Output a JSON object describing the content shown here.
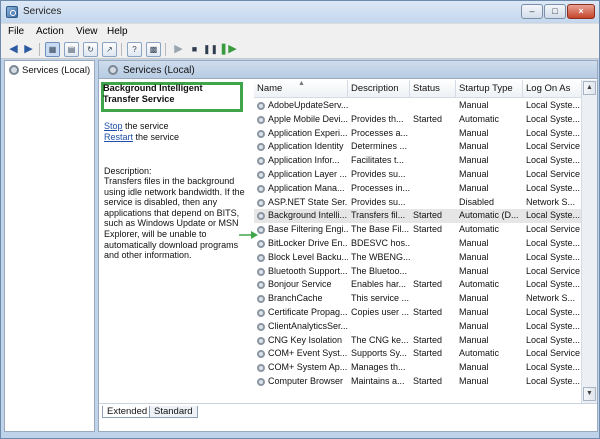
{
  "window": {
    "title": "Services"
  },
  "menu": [
    "File",
    "Action",
    "View",
    "Help"
  ],
  "toolbar": {
    "buttons": [
      "back",
      "forward",
      "show-console-tree",
      "properties",
      "refresh",
      "export-list",
      "help",
      "action-pane",
      "start",
      "stop",
      "pause",
      "restart"
    ]
  },
  "tree": {
    "root_label": "Services (Local)"
  },
  "right_header": {
    "label": "Services (Local)"
  },
  "details": {
    "selected_title": "Background Intelligent Transfer Service",
    "stop_link": "Stop",
    "stop_rest": " the service",
    "restart_link": "Restart",
    "restart_rest": " the service",
    "description_label": "Description:",
    "description_text": "Transfers files in the background using idle network bandwidth. If the service is disabled, then any applications that depend on BITS, such as Windows Update or MSN Explorer, will be unable to automatically download programs and other information."
  },
  "table": {
    "columns": [
      "Name",
      "Description",
      "Status",
      "Startup Type",
      "Log On As"
    ],
    "rows": [
      [
        "AdobeUpdateServ...",
        "",
        "",
        "Manual",
        "Local Syste..."
      ],
      [
        "Apple Mobile Devi...",
        "Provides th...",
        "Started",
        "Automatic",
        "Local Syste..."
      ],
      [
        "Application Experi...",
        "Processes a...",
        "",
        "Manual",
        "Local Syste..."
      ],
      [
        "Application Identity",
        "Determines ...",
        "",
        "Manual",
        "Local Service"
      ],
      [
        "Application Infor...",
        "Facilitates t...",
        "",
        "Manual",
        "Local Syste..."
      ],
      [
        "Application Layer ...",
        "Provides su...",
        "",
        "Manual",
        "Local Service"
      ],
      [
        "Application Mana...",
        "Processes in...",
        "",
        "Manual",
        "Local Syste..."
      ],
      [
        "ASP.NET State Ser...",
        "Provides su...",
        "",
        "Disabled",
        "Network S..."
      ],
      [
        "Background Intelli...",
        "Transfers fil...",
        "Started",
        "Automatic (D...",
        "Local Syste..."
      ],
      [
        "Base Filtering Engi...",
        "The Base Fil...",
        "Started",
        "Automatic",
        "Local Service"
      ],
      [
        "BitLocker Drive En...",
        "BDESVC hos...",
        "",
        "Manual",
        "Local Syste..."
      ],
      [
        "Block Level Backu...",
        "The WBENG...",
        "",
        "Manual",
        "Local Syste..."
      ],
      [
        "Bluetooth Support...",
        "The Bluetoo...",
        "",
        "Manual",
        "Local Service"
      ],
      [
        "Bonjour Service",
        "Enables har...",
        "Started",
        "Automatic",
        "Local Syste..."
      ],
      [
        "BranchCache",
        "This service ...",
        "",
        "Manual",
        "Network S..."
      ],
      [
        "Certificate Propag...",
        "Copies user ...",
        "Started",
        "Manual",
        "Local Syste..."
      ],
      [
        "ClientAnalyticsSer...",
        "",
        "",
        "Manual",
        "Local Syste..."
      ],
      [
        "CNG Key Isolation",
        "The CNG ke...",
        "Started",
        "Manual",
        "Local Syste..."
      ],
      [
        "COM+ Event Syst...",
        "Supports Sy...",
        "Started",
        "Automatic",
        "Local Service"
      ],
      [
        "COM+ System Ap...",
        "Manages th...",
        "",
        "Manual",
        "Local Syste..."
      ],
      [
        "Computer Browser",
        "Maintains a...",
        "Started",
        "Manual",
        "Local Syste..."
      ]
    ],
    "selected_index": 8
  },
  "tabs": [
    "Extended",
    "Standard"
  ],
  "colors": {
    "highlight_box": "#3fa54a",
    "arrow": "#3fa54a",
    "link": "#1f4fa8"
  }
}
